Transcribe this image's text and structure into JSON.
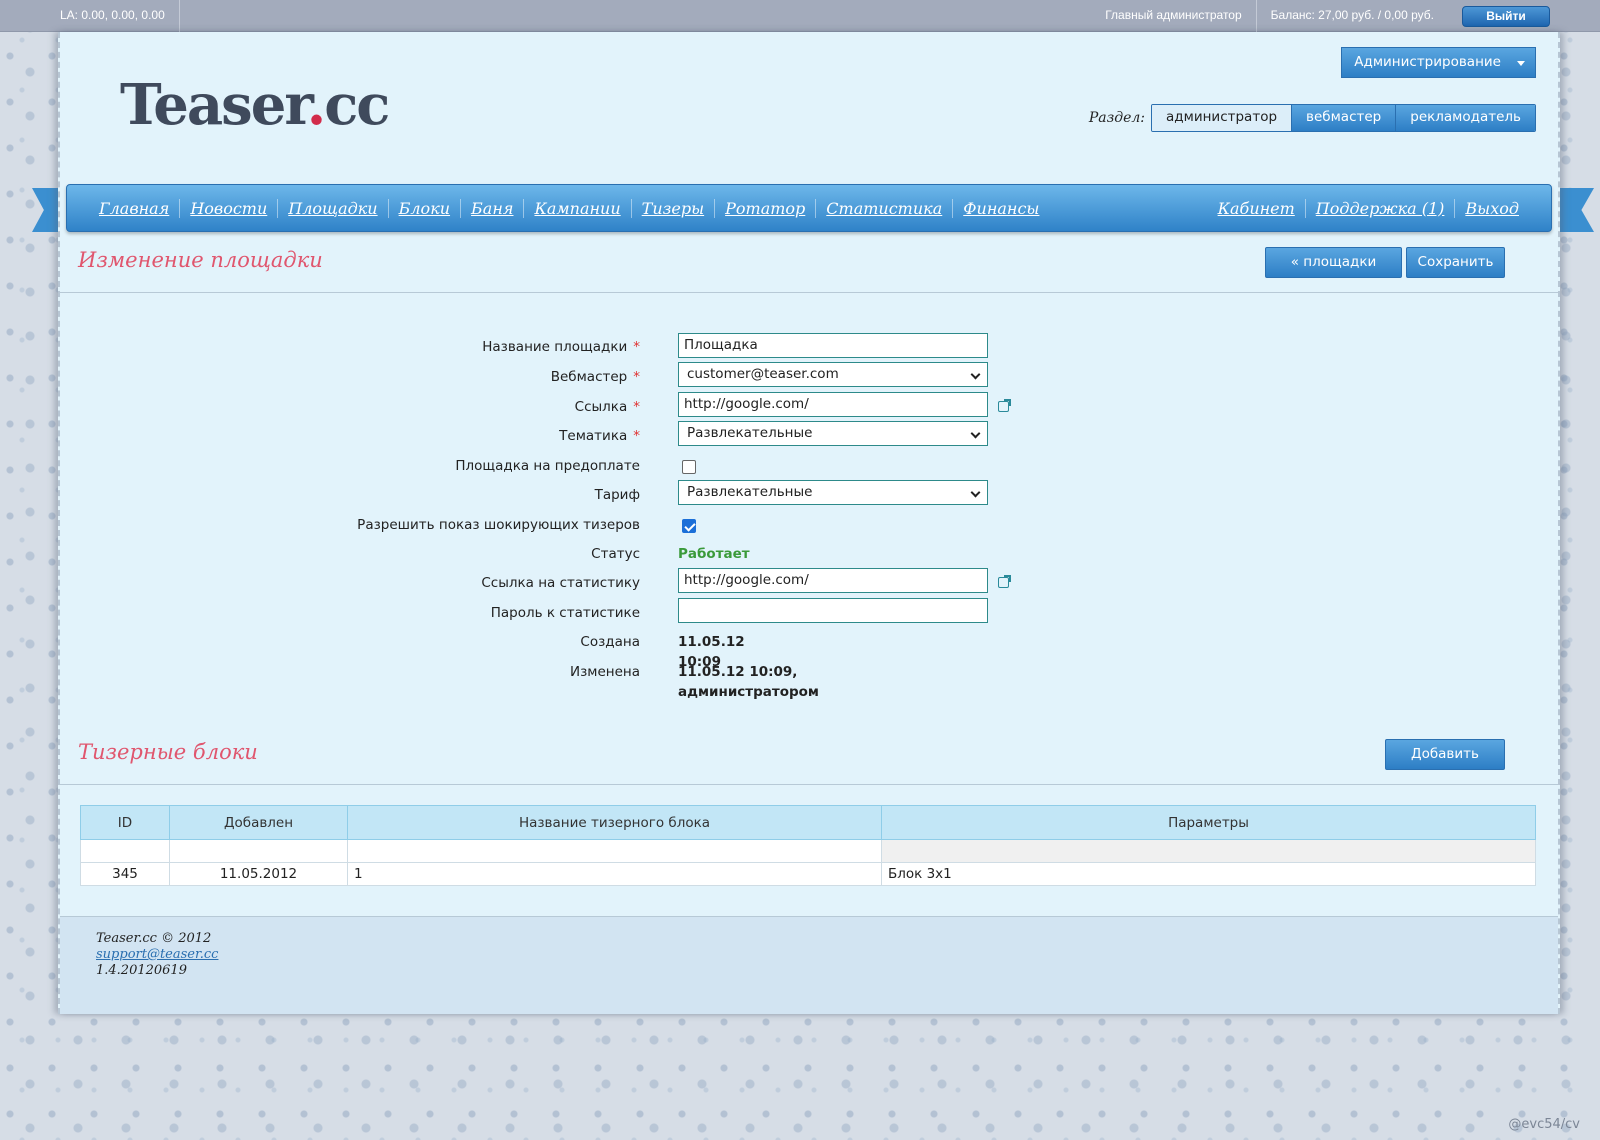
{
  "topbar": {
    "la": "LA: 0.00, 0.00, 0.00",
    "user_role": "Главный администратор",
    "balance": "Баланс: 27,00 руб. / 0,00 руб.",
    "logout_label": "Выйти"
  },
  "header": {
    "logo_text": "Teaser",
    "logo_dot": ".",
    "logo_suffix": "cc",
    "admin_menu_label": "Администрирование",
    "section_label": "Раздел:",
    "sections": [
      "администратор",
      "вебмастер",
      "рекламодатель"
    ],
    "active_section": "администратор"
  },
  "nav": {
    "left": [
      "Главная",
      "Новости",
      "Площадки",
      "Блоки",
      "Баня",
      "Кампании",
      "Тизеры",
      "Ротатор",
      "Статистика",
      "Финансы"
    ],
    "right": [
      "Кабинет",
      "Поддержка (1)",
      "Выход"
    ]
  },
  "edit": {
    "title": "Изменение площадки",
    "back_button": "« площадки",
    "save_button": "Сохранить"
  },
  "form": {
    "name_label": "Название площадки",
    "name_value": "Площадка",
    "webmaster_label": "Вебмастер",
    "webmaster_value": "customer@teaser.com",
    "url_label": "Ссылка",
    "url_value": "http://google.com/",
    "topic_label": "Тематика",
    "topic_value": "Развлекательные",
    "prepay_label": "Площадка на предоплате",
    "prepay_checked": false,
    "tariff_label": "Тариф",
    "tariff_value": "Развлекательные",
    "shock_label": "Разрешить показ шокирующих тизеров",
    "shock_checked": true,
    "status_label": "Статус",
    "status_value": "Работает",
    "stats_url_label": "Ссылка на статистику",
    "stats_url_value": "http://google.com/",
    "stats_pass_label": "Пароль к статистике",
    "stats_pass_value": "",
    "created_label": "Создана",
    "created_value": "11.05.12 10:09",
    "modified_label": "Изменена",
    "modified_value": "11.05.12 10:09, администратором",
    "required_mark": "*"
  },
  "blocks": {
    "title": "Тизерные блоки",
    "add_button": "Добавить",
    "columns": [
      "ID",
      "Добавлен",
      "Название тизерного блока",
      "Параметры"
    ],
    "rows": [
      {
        "id": "345",
        "added": "11.05.2012",
        "name": "1",
        "params": "Блок 3x1"
      }
    ]
  },
  "footer": {
    "copyright": "Teaser.cc © 2012",
    "email": "support@teaser.cc",
    "version": "1.4.20120619"
  },
  "watermark": "@evc54/cv",
  "colors": {
    "accent": "#2d7ec5",
    "title_pink": "#e0566e",
    "status_green": "#3a9a3a"
  }
}
